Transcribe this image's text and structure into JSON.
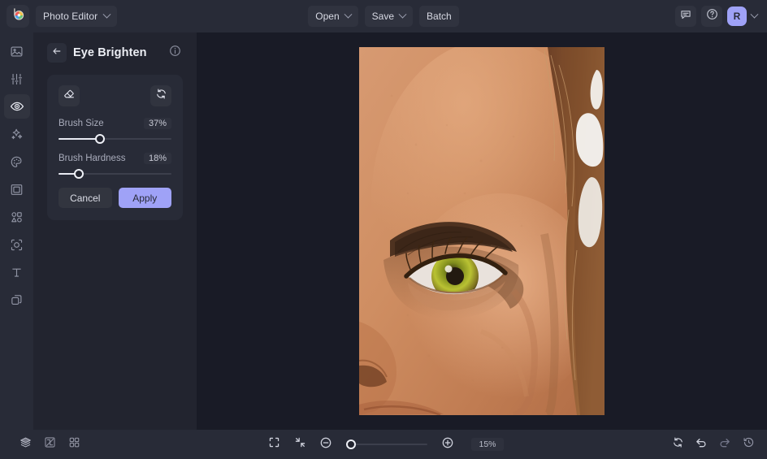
{
  "app": {
    "logo_icon": "color-wheel-logo",
    "menu_label": "Photo Editor"
  },
  "topbar": {
    "open_label": "Open",
    "save_label": "Save",
    "batch_label": "Batch",
    "feedback_icon": "chat-bubble-icon",
    "help_icon": "question-circle-icon",
    "avatar_initial": "R",
    "avatar_color": "#9fa2f7"
  },
  "rail": {
    "items": [
      {
        "name": "image-tool",
        "icon": "image-icon",
        "active": false
      },
      {
        "name": "adjust-tool",
        "icon": "sliders-icon",
        "active": false
      },
      {
        "name": "retouch-tool",
        "icon": "eye-icon",
        "active": true
      },
      {
        "name": "effects-tool",
        "icon": "sparkles-icon",
        "active": false
      },
      {
        "name": "color-tool",
        "icon": "palette-icon",
        "active": false
      },
      {
        "name": "frame-tool",
        "icon": "frame-icon",
        "active": false
      },
      {
        "name": "shapes-tool",
        "icon": "shapes-icon",
        "active": false
      },
      {
        "name": "filter-tool",
        "icon": "filter-frame-icon",
        "active": false
      },
      {
        "name": "text-tool",
        "icon": "text-icon",
        "active": false
      },
      {
        "name": "layers-tool",
        "icon": "layers-copy-icon",
        "active": false
      }
    ]
  },
  "panel": {
    "back_icon": "arrow-left-icon",
    "title": "Eye Brighten",
    "info_icon": "info-circle-icon",
    "eraser_icon": "eraser-icon",
    "reset_icon": "reset-circular-arrows-icon",
    "sliders": [
      {
        "label": "Brush Size",
        "value": 37,
        "display": "37%"
      },
      {
        "label": "Brush Hardness",
        "value": 18,
        "display": "18%"
      }
    ],
    "cancel_label": "Cancel",
    "apply_label": "Apply",
    "apply_color": "#9fa2f7"
  },
  "canvas": {
    "background": "#191b26",
    "photo_alt": "close-up portrait of a face showing one eye and cheek"
  },
  "bottombar": {
    "layers_icon": "layers-stack-icon",
    "compare_icon": "compare-split-icon",
    "grid_icon": "grid-four-icon",
    "fit_icon": "fit-screen-icon",
    "actual_size_icon": "collapse-arrows-icon",
    "zoom_out_icon": "minus-circle-icon",
    "zoom_in_icon": "plus-circle-icon",
    "zoom_value": 15,
    "zoom_display": "15%",
    "reset_icon": "reset-circular-arrows-icon",
    "undo_icon": "undo-arrow-icon",
    "redo_icon": "redo-arrow-icon",
    "history_icon": "history-clock-icon"
  }
}
